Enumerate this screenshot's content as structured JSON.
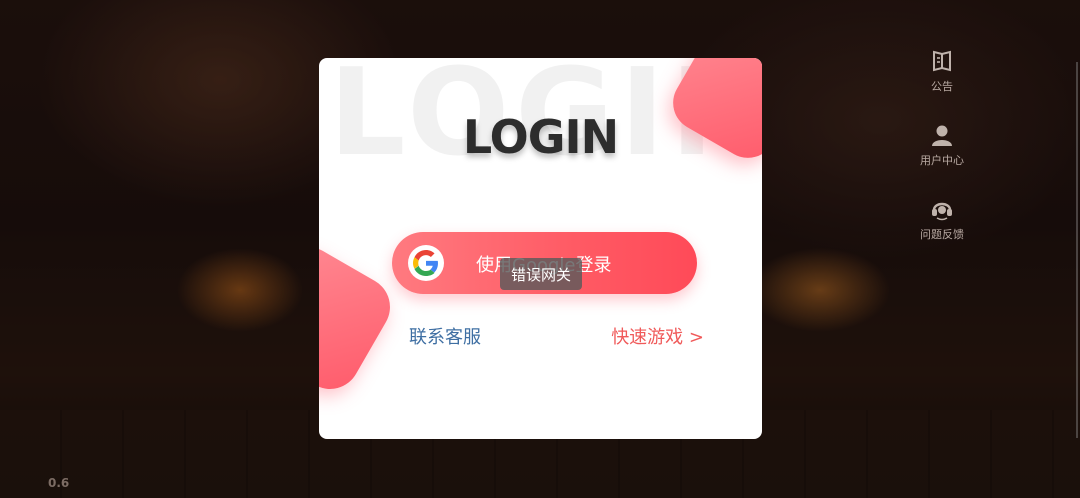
{
  "version": "0.6",
  "side_menu": [
    {
      "icon": "notice-icon",
      "label": "公告"
    },
    {
      "icon": "user-icon",
      "label": "用户中心"
    },
    {
      "icon": "headset-icon",
      "label": "问题反馈"
    }
  ],
  "dialog": {
    "title": "LOGIN",
    "google_button_label": "使用Google登录",
    "toast": "错误网关",
    "contact_link": "联系客服",
    "quick_play_link": "快速游戏 >"
  },
  "colors": {
    "accent": "#ff5a64",
    "link_blue": "#3f6fa3",
    "link_red": "#f05a5a"
  }
}
